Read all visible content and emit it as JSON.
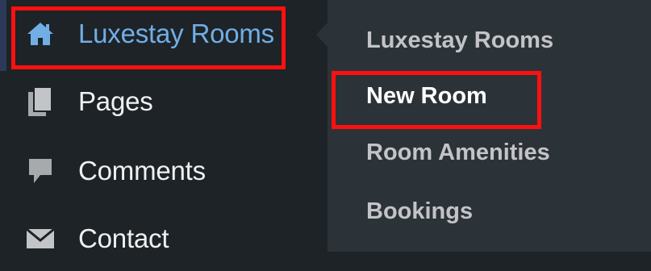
{
  "sidebar": {
    "items": [
      {
        "label": "Luxestay Rooms",
        "icon": "home-icon",
        "current": true
      },
      {
        "label": "Pages",
        "icon": "pages-icon"
      },
      {
        "label": "Comments",
        "icon": "comment-icon"
      },
      {
        "label": "Contact",
        "icon": "mail-icon"
      }
    ]
  },
  "submenu": {
    "items": [
      {
        "label": "Luxestay Rooms"
      },
      {
        "label": "New Room",
        "active": true
      },
      {
        "label": "Room Amenities"
      },
      {
        "label": "Bookings"
      }
    ]
  },
  "colors": {
    "sidebar_bg": "#1d2327",
    "submenu_bg": "#2c3338",
    "current_text": "#72aee6",
    "highlight": "#ff1010"
  }
}
